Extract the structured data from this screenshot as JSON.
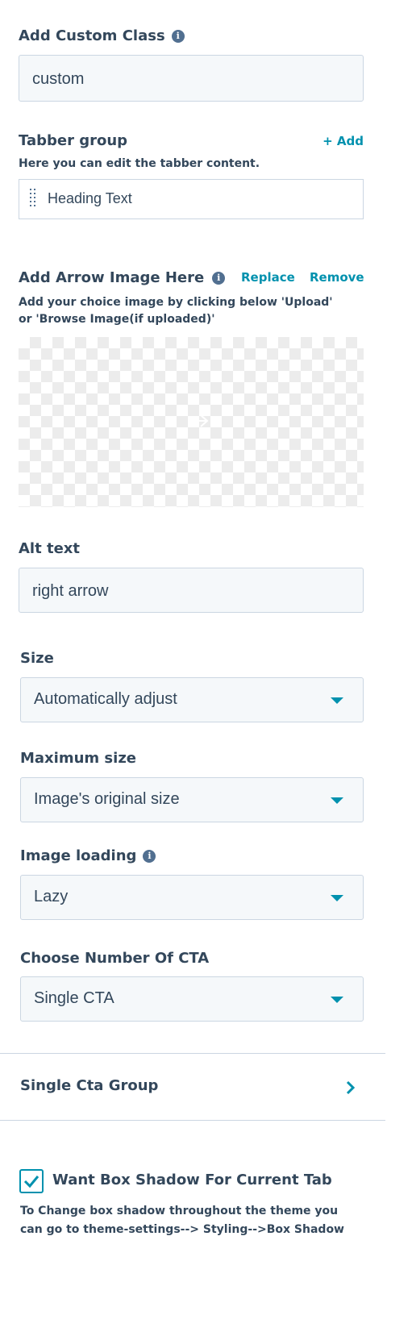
{
  "custom_class": {
    "label": "Add Custom Class",
    "value": "custom"
  },
  "tabber": {
    "label": "Tabber group",
    "add_label": "+ Add",
    "help": "Here you can edit the tabber content.",
    "items": [
      {
        "label": "Heading Text"
      }
    ]
  },
  "arrow_image": {
    "label": "Add Arrow Image Here",
    "replace_label": "Replace",
    "remove_label": "Remove",
    "help_line1": "Add your choice image by clicking below 'Upload'",
    "help_line2": "or 'Browse Image(if uploaded)'"
  },
  "alt_text": {
    "label": "Alt text",
    "value": "right arrow"
  },
  "size": {
    "label": "Size",
    "value": "Automatically adjust"
  },
  "max_size": {
    "label": "Maximum size",
    "value": "Image's original size"
  },
  "image_loading": {
    "label": "Image loading",
    "value": "Lazy"
  },
  "cta_count": {
    "label": "Choose Number Of CTA",
    "value": "Single CTA"
  },
  "cta_group": {
    "label": "Single Cta Group"
  },
  "box_shadow": {
    "label": "Want Box Shadow For Current Tab",
    "checked": true,
    "help_line1": "To Change box shadow throughout the theme you",
    "help_line2": "can go to theme-settings--> Styling-->Box Shadow"
  },
  "colors": {
    "accent": "#0091ae",
    "text": "#33475b",
    "field_bg": "#f5f8fa",
    "border": "#cbd6e2"
  },
  "icons": {
    "info": "info-icon",
    "drag": "drag-handle-icon",
    "caret": "caret-down-icon",
    "chevron": "chevron-right-icon",
    "check": "checkbox-check-icon"
  }
}
